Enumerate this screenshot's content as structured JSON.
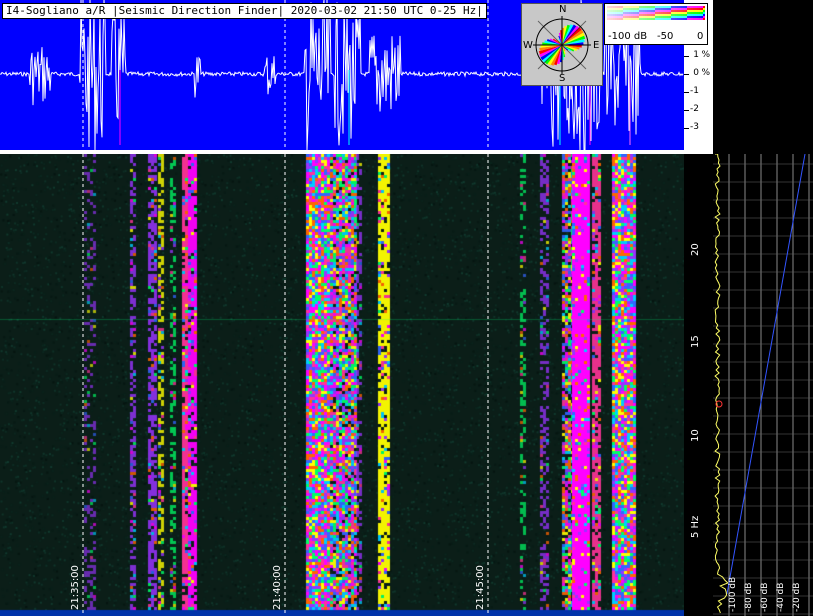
{
  "title": "I4-Sogliano a/R |Seismic Direction Finder| 2020-03-02 21:50 UTC 0-25 Hz|",
  "seismo_axis": {
    "ticks": [
      "1",
      "0",
      "-1",
      "-2",
      "-3"
    ],
    "unit_marks": [
      "%",
      "%"
    ]
  },
  "compass": {
    "n": "N",
    "s": "S",
    "e": "E",
    "w": "W"
  },
  "legend": {
    "left": "-100 dB",
    "mid": "-50",
    "right": "0"
  },
  "freq_axis": {
    "ticks": [
      "20",
      "15",
      "10",
      "5 Hz"
    ]
  },
  "time_labels": [
    "21:35:00",
    "21:40:00",
    "21:45:00"
  ],
  "profile_labels": [
    "-100 dB",
    "-80 dB",
    "-60 dB",
    "-40 dB",
    "-20 dB"
  ],
  "colors": {
    "seismo_bg": "#0000ff",
    "spec_bg": "#0b1e18",
    "trace": "#ffffff",
    "profile": "#ffff66"
  }
}
